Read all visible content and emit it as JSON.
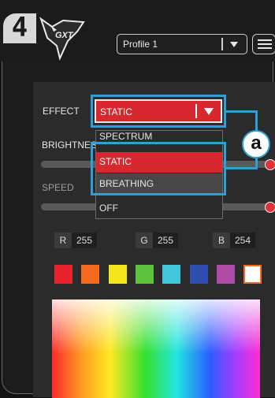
{
  "step": {
    "number": "4"
  },
  "logo": {
    "text": "GXT"
  },
  "profile": {
    "selected": "Profile 1"
  },
  "settings": {
    "effect_label": "EFFECT",
    "brightness_label": "BRIGHTNESS",
    "speed_label": "SPEED",
    "brightness_value": 1.0,
    "speed_value": 1.0
  },
  "effect": {
    "selected": "STATIC",
    "options": [
      "SPECTRUM",
      "STATIC",
      "BREATHING",
      "OFF"
    ]
  },
  "callout": {
    "letter": "a",
    "color": "#2f9fd7"
  },
  "rgb": {
    "r_label": "R",
    "r": "255",
    "g_label": "G",
    "g": "255",
    "b_label": "B",
    "b": "254"
  },
  "swatches": [
    "#e8232b",
    "#f56a1c",
    "#f3e61b",
    "#5cc13b",
    "#41c6de",
    "#2f4fb0",
    "#b04aa8",
    "#ffffff"
  ],
  "accent": "#d7282f"
}
